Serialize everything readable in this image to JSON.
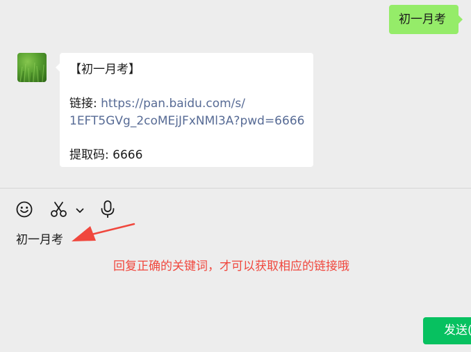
{
  "chat": {
    "sent_message": "初一月考",
    "received_message": {
      "title": "【初一月考】",
      "link_label": "链接: ",
      "link_url_line1": "https://pan.baidu.com/s/",
      "link_url_line2": "1EFT5GVg_2coMEjJFxNMl3A?pwd=6666",
      "code_line": "提取码: 6666"
    }
  },
  "input": {
    "typed_text": "初一月考",
    "send_label": "发送(S)"
  },
  "annotation": {
    "text": "回复正确的关键词，才可以获取相应的链接哦",
    "color": "#f0473d"
  },
  "colors": {
    "sent_bubble": "#95ec69",
    "link": "#576b95",
    "send_button": "#07c160",
    "background": "#ededed"
  },
  "icons": {
    "toolbar": [
      "emoji-icon",
      "scissors-icon",
      "chevron-down-icon",
      "microphone-icon"
    ],
    "annotation": "arrow-icon"
  }
}
